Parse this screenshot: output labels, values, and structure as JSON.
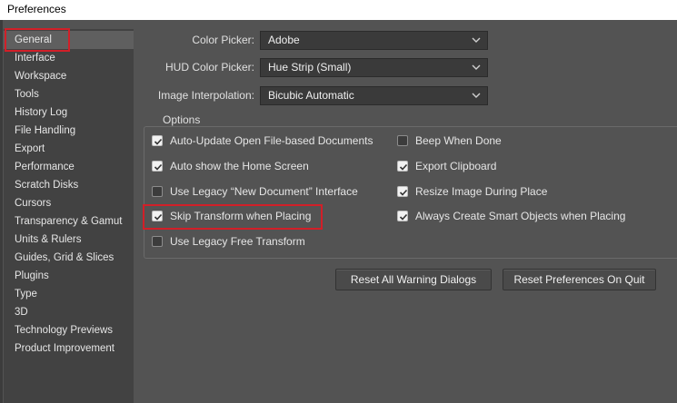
{
  "window": {
    "title": "Preferences"
  },
  "sidebar": {
    "items": [
      {
        "label": "General"
      },
      {
        "label": "Interface"
      },
      {
        "label": "Workspace"
      },
      {
        "label": "Tools"
      },
      {
        "label": "History Log"
      },
      {
        "label": "File Handling"
      },
      {
        "label": "Export"
      },
      {
        "label": "Performance"
      },
      {
        "label": "Scratch Disks"
      },
      {
        "label": "Cursors"
      },
      {
        "label": "Transparency & Gamut"
      },
      {
        "label": "Units & Rulers"
      },
      {
        "label": "Guides, Grid & Slices"
      },
      {
        "label": "Plugins"
      },
      {
        "label": "Type"
      },
      {
        "label": "3D"
      },
      {
        "label": "Technology Previews"
      },
      {
        "label": "Product Improvement"
      }
    ],
    "selected": "General"
  },
  "general": {
    "color_picker": {
      "label": "Color Picker:",
      "value": "Adobe"
    },
    "hud_color_picker": {
      "label": "HUD Color Picker:",
      "value": "Hue Strip (Small)"
    },
    "image_interpolation": {
      "label": "Image Interpolation:",
      "value": "Bicubic Automatic"
    }
  },
  "options": {
    "legend": "Options",
    "left": [
      {
        "label": "Auto-Update Open File-based Documents",
        "checked": true
      },
      {
        "label": "Auto show the Home Screen",
        "checked": true
      },
      {
        "label": "Use Legacy “New Document” Interface",
        "checked": false
      },
      {
        "label": "Skip Transform when Placing",
        "checked": true
      },
      {
        "label": "Use Legacy Free Transform",
        "checked": false
      }
    ],
    "right": [
      {
        "label": "Beep When Done",
        "checked": false
      },
      {
        "label": "Export Clipboard",
        "checked": true
      },
      {
        "label": "Resize Image During Place",
        "checked": true
      },
      {
        "label": "Always Create Smart Objects when Placing",
        "checked": true
      }
    ]
  },
  "buttons": {
    "reset_warnings": "Reset All Warning Dialogs",
    "reset_prefs": "Reset Preferences On Quit"
  },
  "colors": {
    "highlight": "#d21f28",
    "panel": "#535353",
    "sidebar": "#424242"
  }
}
